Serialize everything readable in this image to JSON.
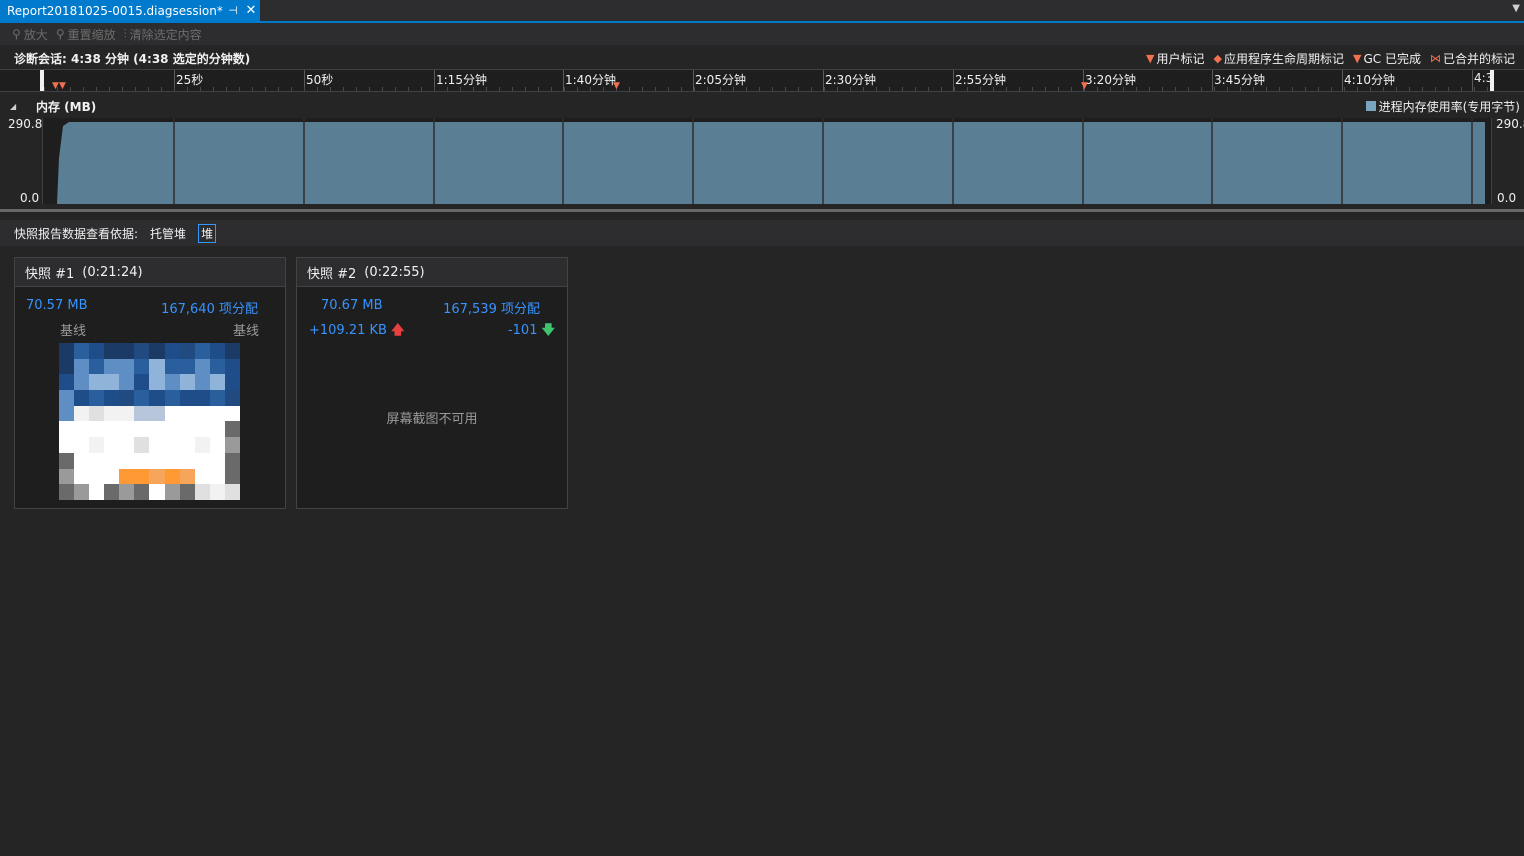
{
  "tab": {
    "title": "Report20181025-0015.diagsession*",
    "pin_glyph": "⊣",
    "close_glyph": "✕",
    "menu_glyph": "▼"
  },
  "toolbar": {
    "zoom_in": "放大",
    "reset_zoom": "重置缩放",
    "clear_selection": "清除选定内容"
  },
  "session": {
    "label": "诊断会话: 4:38 分钟 (4:38 选定的分钟数)",
    "legend": [
      {
        "name": "user-mark",
        "marker": "▼",
        "label": "用户标记",
        "color": "#f07050"
      },
      {
        "name": "lifecycle-mark",
        "marker": "◆",
        "label": "应用程序生命周期标记",
        "color": "#f07050"
      },
      {
        "name": "gc-done",
        "marker": "▼",
        "label": "GC 已完成",
        "color": "#f07050"
      },
      {
        "name": "merged-mark",
        "marker": "⋈",
        "label": "已合并的标记",
        "color": "#f07050"
      }
    ]
  },
  "ruler": {
    "labels": [
      "25秒",
      "50秒",
      "1:15分钟",
      "1:40分钟",
      "2:05分钟",
      "2:30分钟",
      "2:55分钟",
      "3:20分钟",
      "3:45分钟",
      "4:10分钟",
      "4:3"
    ]
  },
  "memory": {
    "title": "内存 (MB)",
    "collapse_glyph": "◢",
    "legend_label": "进程内存使用率(专用字节)",
    "series_color": "#5a7f95",
    "y_max_label": "290.8",
    "y_min_label": "0.0"
  },
  "snapshot_bar": {
    "label": "快照报告数据查看依据:",
    "option_managed": "托管堆",
    "option_native": "堆"
  },
  "snapshots": [
    {
      "title": "快照 #1",
      "time": "(0:21:24)",
      "size": "70.57 MB",
      "allocations": "167,640 项分配",
      "size_diff": "基线",
      "alloc_diff": "基线"
    },
    {
      "title": "快照 #2",
      "time": "(0:22:55)",
      "size": "70.67 MB",
      "allocations": "167,539 项分配",
      "size_diff": "+109.21 KB",
      "alloc_diff": "-101",
      "up_glyph": "🡅",
      "down_glyph": "🡇",
      "no_screenshot": "屏幕截图不可用"
    }
  ]
}
